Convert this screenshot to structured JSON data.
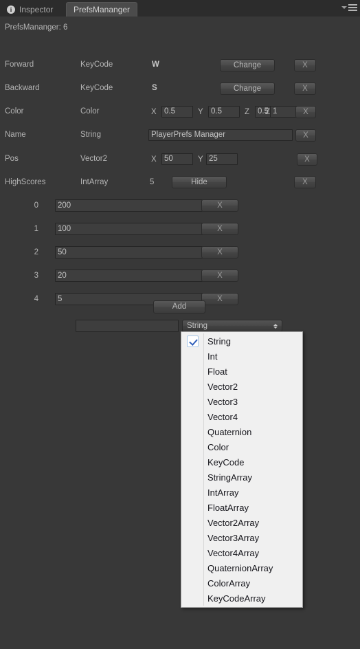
{
  "window": {
    "tabs": [
      {
        "label": "Inspector",
        "icon": "info-icon",
        "active": false
      },
      {
        "label": "PrefsMananger",
        "active": true
      }
    ],
    "menu_icon": "tab-menu-icon"
  },
  "header": {
    "title": "PrefsMananger: 6"
  },
  "rows": [
    {
      "name": "Forward",
      "type": "KeyCode",
      "value": "W",
      "action_label": "Change",
      "delete_label": "X"
    },
    {
      "name": "Backward",
      "type": "KeyCode",
      "value": "S",
      "action_label": "Change",
      "delete_label": "X"
    },
    {
      "name": "Color",
      "type": "Color",
      "components": [
        {
          "axis": "X",
          "value": "0.5"
        },
        {
          "axis": "Y",
          "value": "0.5"
        },
        {
          "axis": "Z",
          "value": "0.5"
        },
        {
          "axis": "Z",
          "value": "1"
        }
      ],
      "delete_label": "X"
    },
    {
      "name": "Name",
      "type": "String",
      "value": "PlayerPrefs Manager",
      "delete_label": "X"
    },
    {
      "name": "Pos",
      "type": "Vector2",
      "components": [
        {
          "axis": "X",
          "value": "50"
        },
        {
          "axis": "Y",
          "value": "25"
        }
      ],
      "delete_label": "X"
    },
    {
      "name": "HighScores",
      "type": "IntArray",
      "count": "5",
      "action_label": "Hide",
      "delete_label": "X"
    }
  ],
  "array_items": [
    {
      "index": "0",
      "value": "200",
      "delete_label": "X"
    },
    {
      "index": "1",
      "value": "100",
      "delete_label": "X"
    },
    {
      "index": "2",
      "value": "50",
      "delete_label": "X"
    },
    {
      "index": "3",
      "value": "20",
      "delete_label": "X"
    },
    {
      "index": "4",
      "value": "5",
      "delete_label": "X"
    }
  ],
  "add_section": {
    "add_label": "Add",
    "new_key_value": "",
    "new_key_placeholder": "",
    "type_selected": "String"
  },
  "type_menu": {
    "selected": "String",
    "options": [
      "String",
      "Int",
      "Float",
      "Vector2",
      "Vector3",
      "Vector4",
      "Quaternion",
      "Color",
      "KeyCode",
      "StringArray",
      "IntArray",
      "FloatArray",
      "Vector2Array",
      "Vector3Array",
      "Vector4Array",
      "QuaternionArray",
      "ColorArray",
      "KeyCodeArray"
    ]
  },
  "colors": {
    "background": "#383838",
    "tabbar": "#2c2c2c",
    "tab_active": "#4b4b4b",
    "field_bg": "#3e3e3e",
    "text": "#b4b4b4",
    "popup_bg": "#f0f0f0",
    "check_accent": "#2f5fbb"
  }
}
